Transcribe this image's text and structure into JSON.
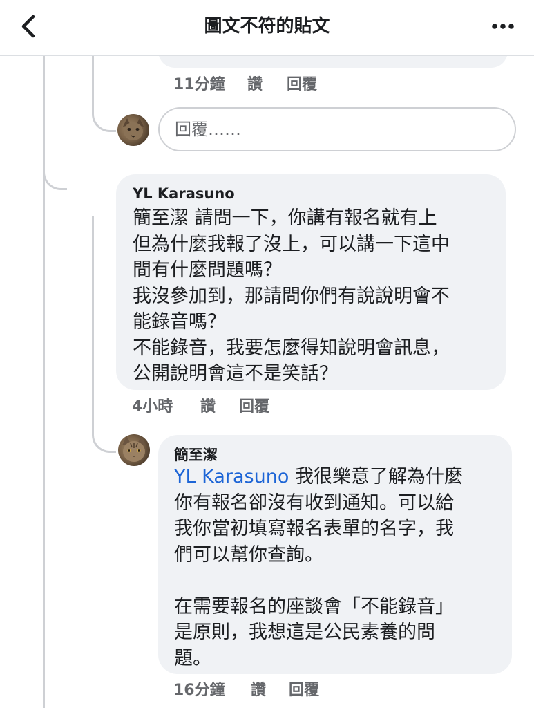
{
  "header": {
    "title": "圖文不符的貼文"
  },
  "comment_above": {
    "time": "11分鐘",
    "like_label": "讚",
    "reply_label": "回覆"
  },
  "reply_input": {
    "placeholder": "回覆……"
  },
  "comment_main": {
    "author": "YL Karasuno",
    "text": "簡至潔 請問一下，你講有報名就有上\n但為什麼我報了沒上，可以講一下這中\n間有什麼問題嗎？\n我沒參加到，那請問你們有說說明會不\n能錄音嗎？\n不能錄音，我要怎麼得知說明會訊息，\n公開說明會這不是笑話？",
    "time": "4小時",
    "like_label": "讚",
    "reply_label": "回覆"
  },
  "reply_comment": {
    "author": "簡至潔",
    "mention": "YL Karasuno",
    "text_line1_after_mention": " 我很樂意了解為什麼",
    "text_rest": "你有報名卻沒有收到通知。可以給\n我你當初填寫報名表單的名字，我\n們可以幫你查詢。\n\n在需要報名的座談會「不能錄音」\n是原則，我想這是公民素養的問\n題。",
    "time": "16分鐘",
    "like_label": "讚",
    "reply_label": "回覆"
  }
}
